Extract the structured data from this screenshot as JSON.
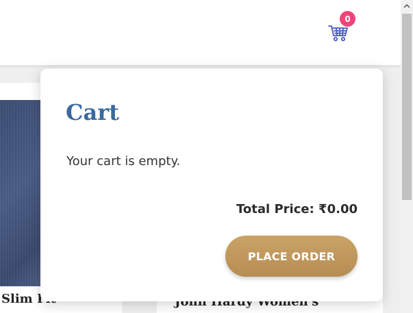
{
  "header": {
    "cart_count": "0"
  },
  "products": [
    {
      "name": "Slim Fit"
    },
    {
      "name": "John Hardy Women's"
    }
  ],
  "cart": {
    "title": "Cart",
    "empty_message": "Your cart is empty.",
    "total_label": "Total Price: ₹0.00",
    "place_order_label": "PLACE ORDER"
  },
  "colors": {
    "badge": "#f0437a",
    "title": "#3a6a9c",
    "button": "#c09a5f",
    "cart_icon": "#4a59c4"
  },
  "icons": {
    "cart": "shopping-cart-icon",
    "scroll_up": "chevron-up-icon"
  }
}
